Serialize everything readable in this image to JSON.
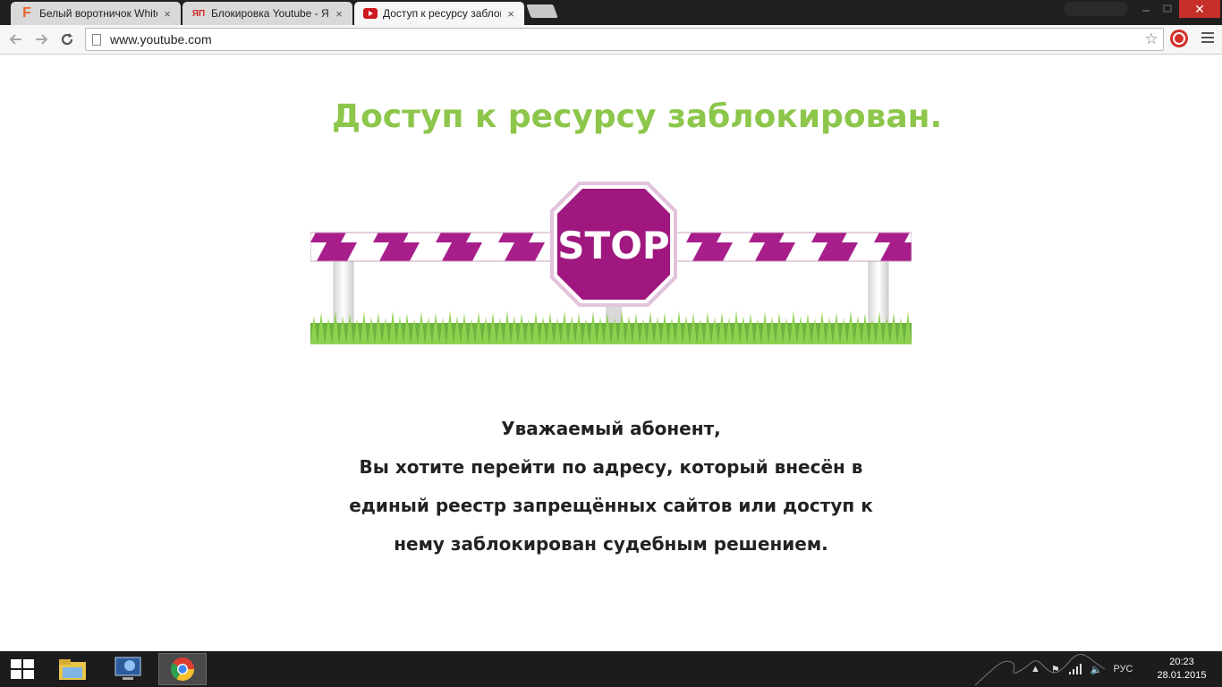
{
  "browser": {
    "tabs": [
      {
        "title": "Белый воротничок White",
        "favicon": "F",
        "favicon_color": "#e8642b"
      },
      {
        "title": "Блокировка Youtube - ЯП",
        "favicon": "ЯП",
        "favicon_color": "#d42a2a"
      },
      {
        "title": "Доступ к ресурсу заблок",
        "favicon": "youtube-icon",
        "favicon_color": "#cc181e"
      }
    ],
    "active_tab_index": 2,
    "close_glyph": "×",
    "window_close_glyph": "✕",
    "address": "www.youtube.com"
  },
  "page": {
    "title": "Доступ к ресурсу заблокирован.",
    "title_color": "#8cc64a",
    "stop_sign_text": "STOP",
    "stop_sign_color": "#9e1b7f",
    "message_lines": [
      "Уважаемый абонент,",
      "Вы хотите перейти по адресу, который внесён в",
      "единый реестр запрещённых сайтов или доступ к",
      "нему заблокирован судебным решением."
    ]
  },
  "taskbar": {
    "language": "РУС",
    "time": "20:23",
    "date": "28.01.2015",
    "pinned": [
      "file-explorer-icon",
      "remote-desktop-icon",
      "chrome-icon"
    ],
    "active_app_index": 2
  }
}
